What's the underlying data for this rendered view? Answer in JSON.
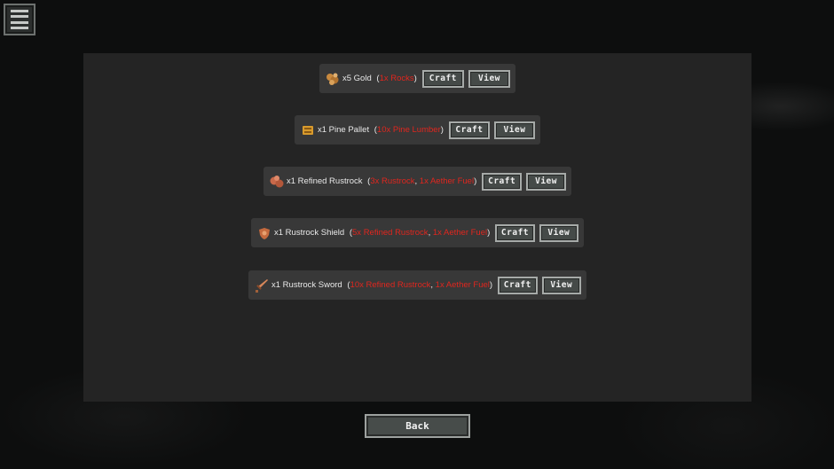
{
  "menu": {
    "icon": "hamburger-menu-icon"
  },
  "recipes": [
    {
      "icon": "gold-ore-icon",
      "output": "x5 Gold",
      "requirements": [
        "1x Rocks"
      ],
      "craft_label": "Craft",
      "view_label": "View"
    },
    {
      "icon": "pine-pallet-icon",
      "output": "x1 Pine Pallet",
      "requirements": [
        "10x Pine Lumber"
      ],
      "craft_label": "Craft",
      "view_label": "View"
    },
    {
      "icon": "rustrock-icon",
      "output": "x1 Refined Rustrock",
      "requirements": [
        "3x Rustrock",
        "1x Aether Fuel"
      ],
      "craft_label": "Craft",
      "view_label": "View"
    },
    {
      "icon": "shield-icon",
      "output": "x1 Rustrock Shield",
      "requirements": [
        "5x Refined Rustrock",
        "1x Aether Fuel"
      ],
      "craft_label": "Craft",
      "view_label": "View"
    },
    {
      "icon": "sword-icon",
      "output": "x1 Rustrock Sword",
      "requirements": [
        "10x Refined Rustrock",
        "1x Aether Fuel"
      ],
      "craft_label": "Craft",
      "view_label": "View"
    }
  ],
  "back_label": "Back",
  "colors": {
    "requirement_text": "#e0261e",
    "panel": "#242424",
    "row": "#383838"
  }
}
